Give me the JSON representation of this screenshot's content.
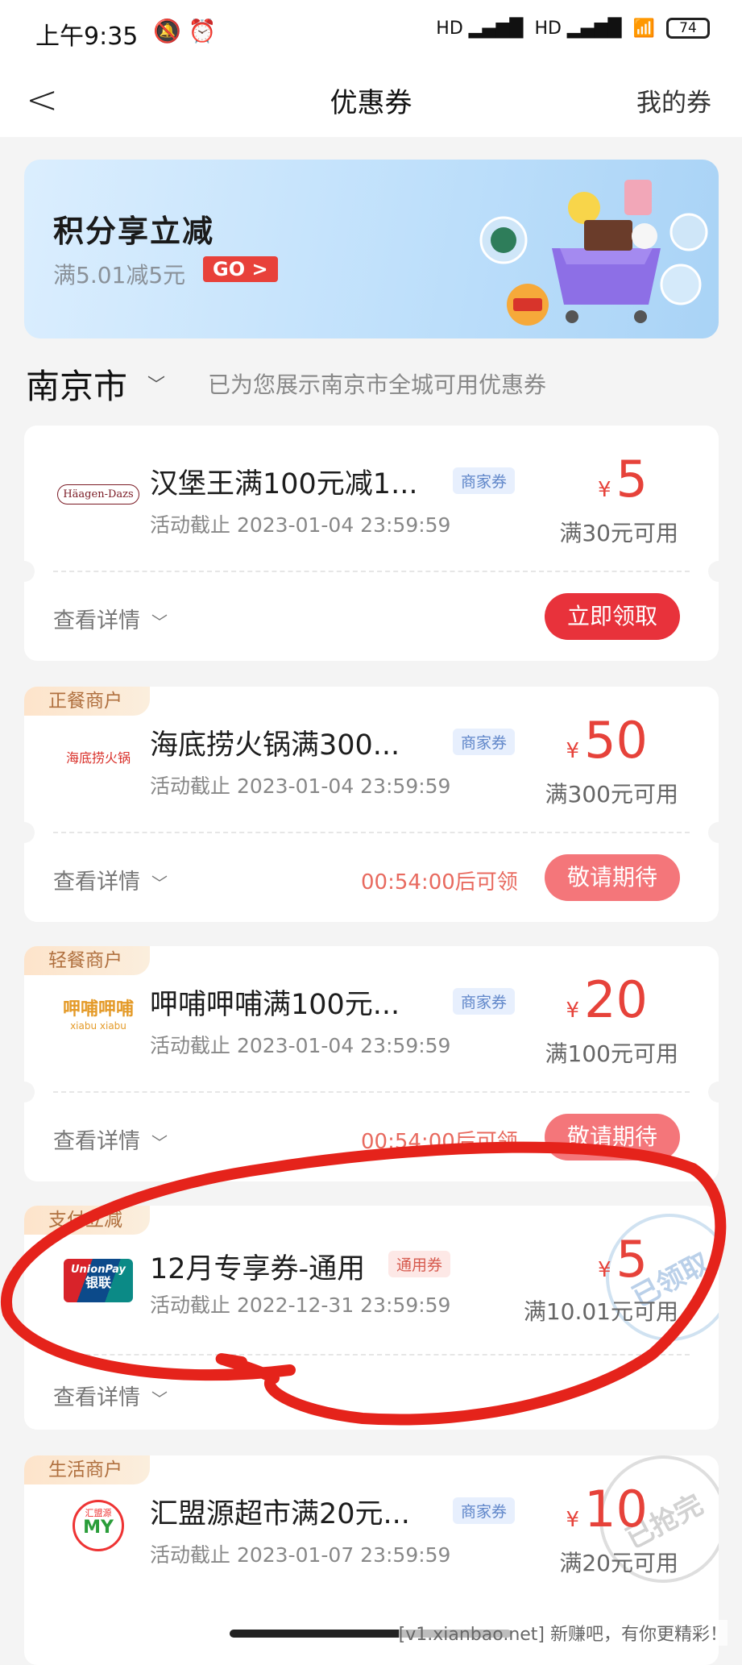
{
  "status_bar": {
    "time": "上午9:35",
    "battery": "74"
  },
  "nav": {
    "back": "<",
    "title": "优惠券",
    "my_coupons": "我的券"
  },
  "banner": {
    "title": "积分享立减",
    "subtitle": "满5.01减5元",
    "go": "GO >"
  },
  "city": {
    "name": "南京市",
    "note": "已为您展示南京市全城可用优惠券"
  },
  "coupons": [
    {
      "tag": "",
      "title": "汉堡王满100元减1...",
      "badge": "商家券",
      "date": "活动截止 2023-01-04 23:59:59",
      "currency": "¥",
      "amount": "5",
      "condition": "满30元可用",
      "detail": "查看详情",
      "countdown": "",
      "button": "立即领取"
    },
    {
      "tag": "正餐商户",
      "title": "海底捞火锅满300...",
      "badge": "商家券",
      "date": "活动截止 2023-01-04 23:59:59",
      "currency": "¥",
      "amount": "50",
      "condition": "满300元可用",
      "detail": "查看详情",
      "countdown": "00:54:00后可领",
      "button": "敬请期待"
    },
    {
      "tag": "轻餐商户",
      "title": "呷哺呷哺满100元...",
      "badge": "商家券",
      "date": "活动截止 2023-01-04 23:59:59",
      "currency": "¥",
      "amount": "20",
      "condition": "满100元可用",
      "detail": "查看详情",
      "countdown": "00:54:00后可领",
      "button": "敬请期待"
    },
    {
      "tag": "支付立减",
      "title": "12月专享券-通用",
      "badge": "通用券",
      "date": "活动截止 2022-12-31 23:59:59",
      "currency": "¥",
      "amount": "5",
      "condition": "满10.01元可用",
      "detail": "查看详情",
      "stamp": "已领取"
    },
    {
      "tag": "生活商户",
      "title": "汇盟源超市满20元...",
      "badge": "商家券",
      "date": "活动截止 2023-01-07 23:59:59",
      "currency": "¥",
      "amount": "10",
      "condition": "满20元可用",
      "stamp": "已抢完"
    }
  ],
  "logos": {
    "haagen": "Häagen-Dazs",
    "haidilao": "海底捞火锅",
    "xiabu": "呷哺呷哺",
    "xiabu_en": "xiabu xiabu",
    "unionpay": "UnionPay",
    "unionpay_cn": "银联",
    "hmy": "汇盟源",
    "hmy_en": "MY"
  },
  "watermark": "[v1.xianbao.net] 新赚吧，有你更精彩！",
  "colors": {
    "accent": "#e8323b",
    "price": "#e6423a",
    "scribble": "#e5231b"
  }
}
